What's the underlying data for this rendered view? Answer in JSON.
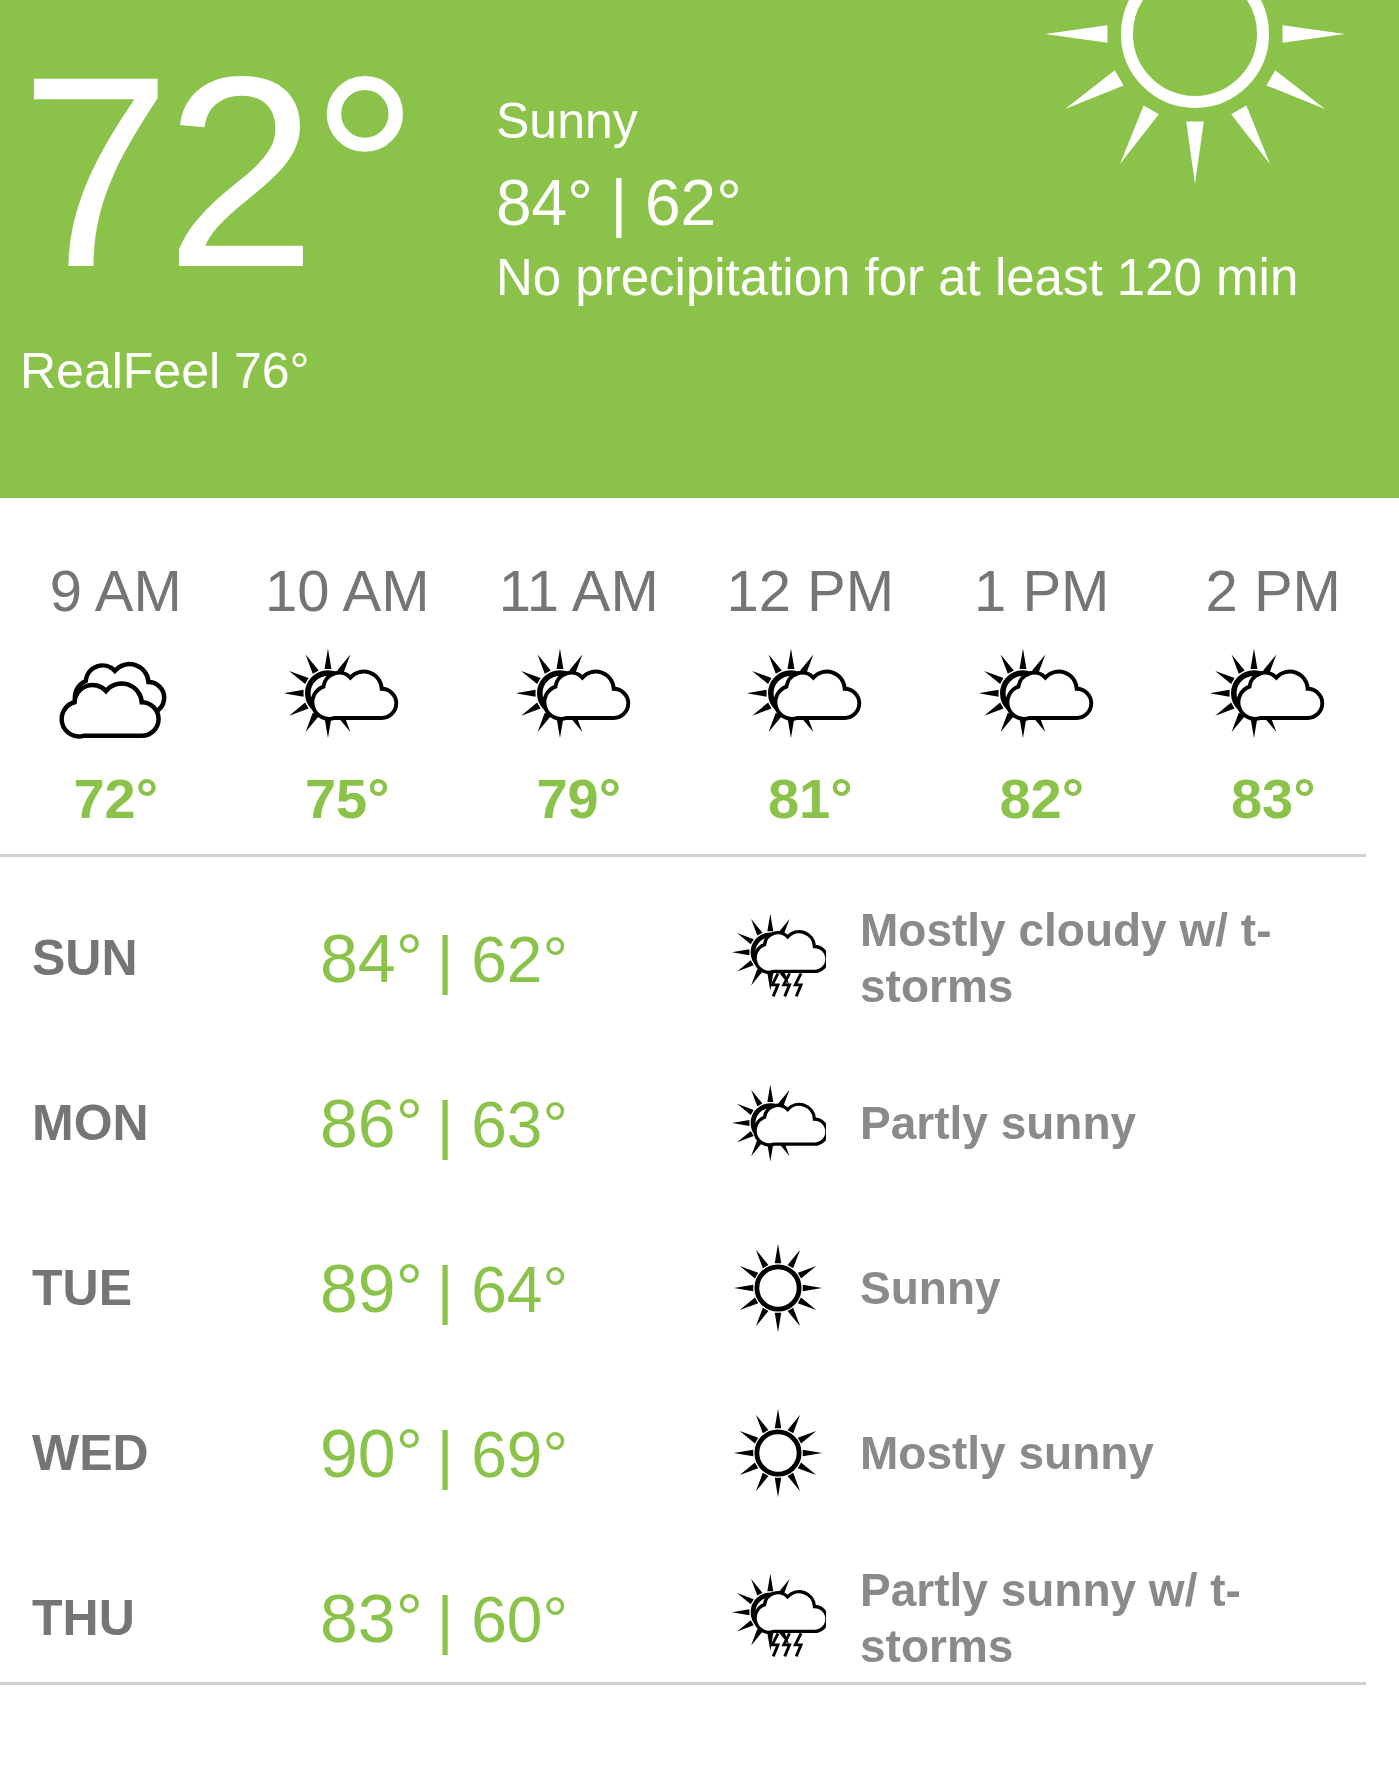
{
  "current": {
    "temperature": "72°",
    "condition": "Sunny",
    "high_low": "84° | 62°",
    "precipitation": "No precipitation for at least 120 min",
    "realfeel": "RealFeel 76°"
  },
  "hourly": [
    {
      "time": "9 AM",
      "kind": "cloudy",
      "temp": "72°"
    },
    {
      "time": "10 AM",
      "kind": "partly_sunny",
      "temp": "75°"
    },
    {
      "time": "11 AM",
      "kind": "partly_sunny",
      "temp": "79°"
    },
    {
      "time": "12 PM",
      "kind": "partly_sunny",
      "temp": "81°"
    },
    {
      "time": "1 PM",
      "kind": "partly_sunny",
      "temp": "82°"
    },
    {
      "time": "2 PM",
      "kind": "partly_sunny",
      "temp": "83°"
    }
  ],
  "daily": [
    {
      "day": "SUN",
      "high": "84°",
      "low": "| 62°",
      "kind": "tstorm",
      "summary": "Mostly cloudy w/ t-storms"
    },
    {
      "day": "MON",
      "high": "86°",
      "low": "| 63°",
      "kind": "partly_sunny",
      "summary": "Partly sunny"
    },
    {
      "day": "TUE",
      "high": "89°",
      "low": "| 64°",
      "kind": "sunny",
      "summary": "Sunny"
    },
    {
      "day": "WED",
      "high": "90°",
      "low": "| 69°",
      "kind": "sunny",
      "summary": "Mostly sunny"
    },
    {
      "day": "THU",
      "high": "83°",
      "low": "| 60°",
      "kind": "tstorm",
      "summary": "Partly sunny w/ t-storms"
    }
  ]
}
